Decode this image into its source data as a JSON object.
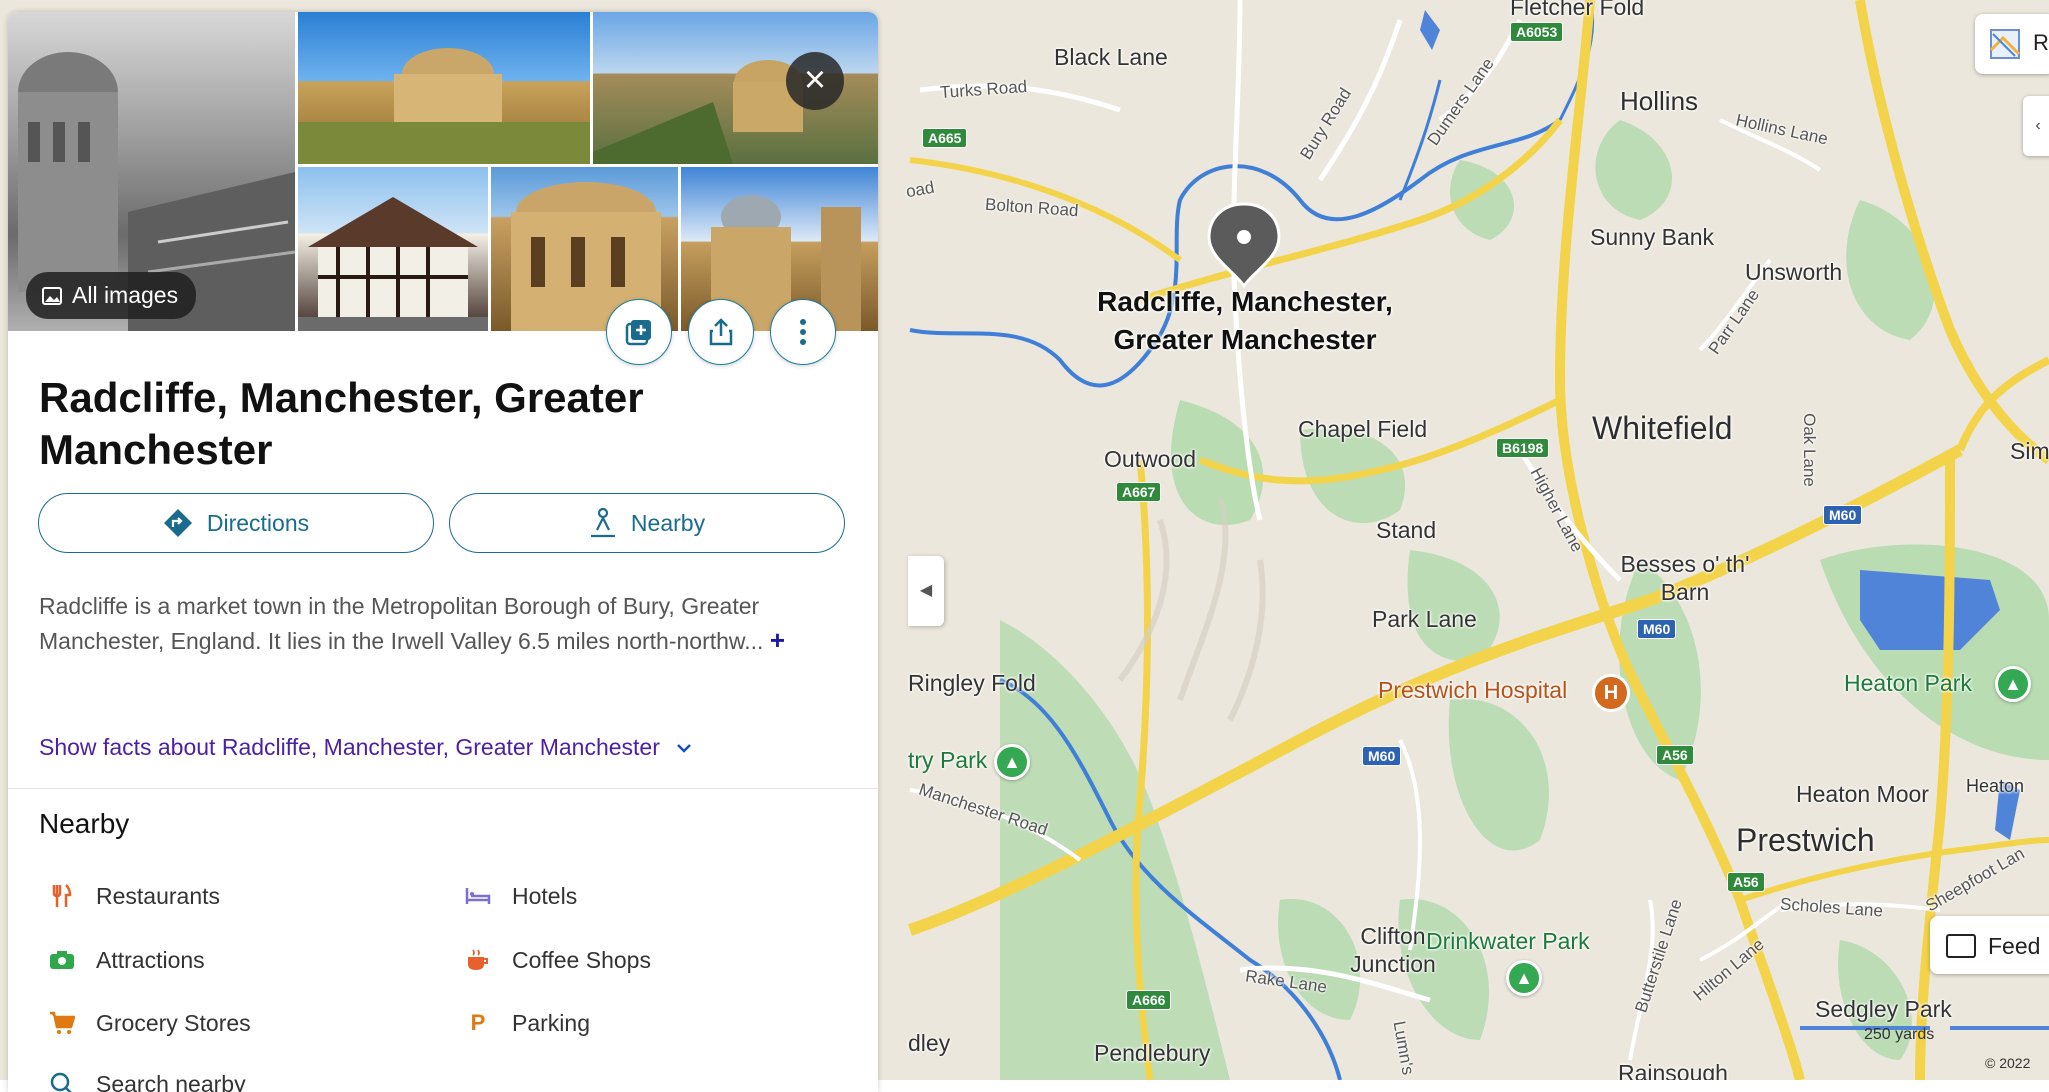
{
  "panel": {
    "all_images_label": "All images",
    "title": "Radcliffe, Manchester, Greater Manchester",
    "directions_label": "Directions",
    "nearby_button_label": "Nearby",
    "description": "Radcliffe is a market town in the Metropolitan Borough of Bury, Greater Manchester, England. It lies in the Irwell Valley 6.5 miles north-northw...",
    "more_symbol": "+",
    "facts_link": "Show facts about Radcliffe, Manchester, Greater Manchester",
    "nearby_header": "Nearby",
    "nearby_items": [
      {
        "label": "Restaurants",
        "icon": "fork-knife-icon",
        "color": "#e8612c"
      },
      {
        "label": "Hotels",
        "icon": "bed-icon",
        "color": "#7b6fd6"
      },
      {
        "label": "Attractions",
        "icon": "camera-icon",
        "color": "#2ea84a"
      },
      {
        "label": "Coffee Shops",
        "icon": "coffee-icon",
        "color": "#e8612c"
      },
      {
        "label": "Grocery Stores",
        "icon": "cart-icon",
        "color": "#e07a10"
      },
      {
        "label": "Parking",
        "icon": "parking-icon",
        "color": "#e07a10"
      },
      {
        "label": "Search nearby",
        "icon": "search-icon",
        "color": "#1a6c8e"
      }
    ],
    "accent_color": "#1a6c8e"
  },
  "map": {
    "pin_label": "Radcliffe, Manchester, Greater Manchester",
    "places": {
      "black_lane": "Black Lane",
      "hollins": "Hollins",
      "sunny_bank": "Sunny Bank",
      "unsworth": "Unsworth",
      "whitefield": "Whitefield",
      "chapel_field": "Chapel Field",
      "outwood": "Outwood",
      "stand": "Stand",
      "besses": "Besses o' th' Barn",
      "park_lane": "Park Lane",
      "ringley_fold": "Ringley Fold",
      "prestwich_hospital": "Prestwich Hospital",
      "heaton_park": "Heaton Park",
      "heaton_moor": "Heaton Moor",
      "heaton": "Heaton",
      "prestwich": "Prestwich",
      "clifton_junction": "Clifton Junction",
      "drinkwater_park": "Drinkwater Park",
      "sedgley_park": "Sedgley Park",
      "pendlebury": "Pendlebury",
      "rainsough": "Rainsough",
      "dley": "dley",
      "try_park": "try Park",
      "sim": "Sim",
      "fletcher_fold": "Fletcher Fold"
    },
    "roads": {
      "turks_road": "Turks Road",
      "bolton_road": "Bolton Road",
      "oad": "oad",
      "bury_road": "Bury Road",
      "dumers_lane": "Dumers Lane",
      "hollins_lane": "Hollins Lane",
      "parr_lane": "Parr Lane",
      "higher_lane": "Higher Lane",
      "oak_lane": "Oak Lane",
      "manchester_road": "Manchester Road",
      "rake_lane": "Rake Lane",
      "butterstile_lane": "Butterstile Lane",
      "hilton_lane": "Hilton Lane",
      "scholes_lane": "Scholes Lane",
      "sheepfoot_lane": "Sheepfoot Lan",
      "lumns": "Lumn's"
    },
    "shields": {
      "a6053": "A6053",
      "a665": "A665",
      "a667": "A667",
      "b6198": "B6198",
      "m60_1": "M60",
      "m60_2": "M60",
      "m60_3": "M60",
      "a56_1": "A56",
      "a56_2": "A56",
      "a666": "A666"
    },
    "feedback_label": "Feed",
    "scale_label": "250 yards",
    "copyright": "© 2022",
    "topright_label": "R"
  }
}
